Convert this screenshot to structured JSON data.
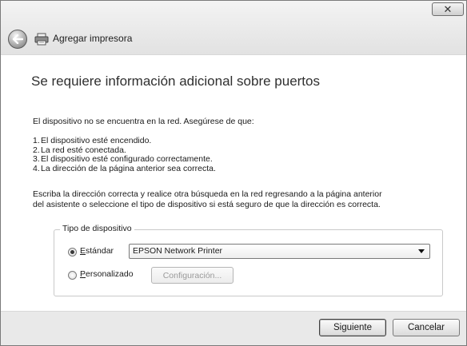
{
  "window": {
    "title": "Agregar impresora",
    "close_glyph": "✕"
  },
  "icons": {
    "back": "back-arrow-icon",
    "printer": "printer-icon",
    "close": "close-icon"
  },
  "content": {
    "heading": "Se requiere información adicional sobre puertos",
    "intro": "El dispositivo no se encuentra en la red. Asegúrese de que:",
    "checklist": [
      {
        "num": "1.",
        "text": "El dispositivo esté encendido."
      },
      {
        "num": "2.",
        "text": "La red esté conectada."
      },
      {
        "num": "3.",
        "text": "El dispositivo esté configurado correctamente."
      },
      {
        "num": "4.",
        "text": "La dirección de la página anterior sea correcta."
      }
    ],
    "instructions_line1": "Escriba la dirección correcta y realice otra búsqueda en la red regresando a la página anterior",
    "instructions_line2": "del asistente o seleccione el tipo de dispositivo si está seguro de que la dirección es correcta."
  },
  "device_type": {
    "group_label": "Tipo de dispositivo",
    "standard": {
      "label_first": "E",
      "label_rest": "stándar",
      "selected": true
    },
    "standard_select_value": "EPSON Network Printer",
    "custom": {
      "label_first": "P",
      "label_rest": "ersonalizado",
      "selected": false
    },
    "config_button": "Configuración..."
  },
  "footer": {
    "next_button": "Siguiente",
    "cancel_button": "Cancelar"
  }
}
